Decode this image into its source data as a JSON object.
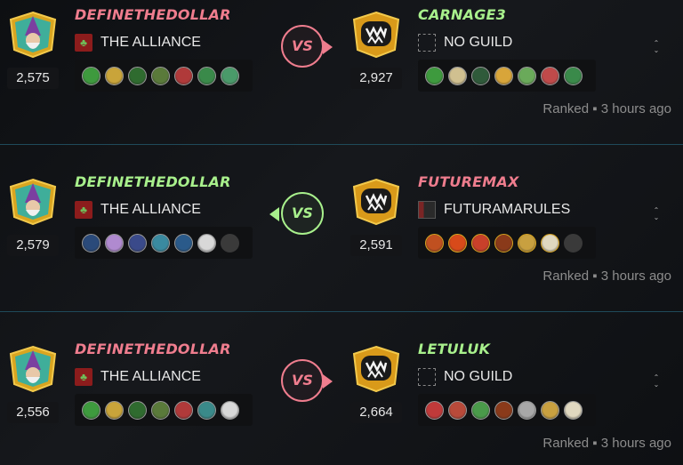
{
  "colors": {
    "win": "#ef7d8e",
    "loss": "#a8f08c",
    "divider": "#1f4a5a"
  },
  "battles": [
    {
      "player": {
        "name": "DEFINETHEDOLLAR",
        "name_color": "#ef7d8e",
        "rating": "2,575",
        "guild": "THE ALLIANCE",
        "guild_icon": "alliance-flag-icon"
      },
      "opponent": {
        "name": "CARNAGE3",
        "name_color": "#a8f08c",
        "rating": "2,927",
        "guild": "NO GUILD",
        "guild_icon": "no-guild-icon"
      },
      "vs_label": "VS",
      "vs_color": "#ef7d8e",
      "vs_arrow": "right",
      "meta": "Ranked ▪ 3 hours ago",
      "player_cards": [
        "#3e9a3e",
        "#c9a43a",
        "#2f6b2f",
        "#5a7a3a",
        "#b03a3a",
        "#3a8a4a",
        "#4a9a6a"
      ],
      "opponent_cards": [
        "#3e9a3e",
        "#d0c090",
        "#2f5a3a",
        "#d8a53a",
        "#6aaa5a",
        "#c04a4a",
        "#3a8a4a"
      ]
    },
    {
      "player": {
        "name": "DEFINETHEDOLLAR",
        "name_color": "#a8f08c",
        "rating": "2,579",
        "guild": "THE ALLIANCE",
        "guild_icon": "alliance-flag-icon"
      },
      "opponent": {
        "name": "FUTUREMAX",
        "name_color": "#ef7d8e",
        "rating": "2,591",
        "guild": "FUTURAMARULES",
        "guild_icon": "futura-guild-icon"
      },
      "vs_label": "VS",
      "vs_color": "#a8f08c",
      "vs_arrow": "left",
      "meta": "Ranked ▪ 3 hours ago",
      "player_cards": [
        "#2a4a7a",
        "#b08ad0",
        "#3a4a8a",
        "#3a8aa0",
        "#2a5a8a",
        "#d8d8d8",
        "#3a3a3a"
      ],
      "opponent_cards": [
        "#c05020",
        "#d84a1a",
        "#c8402a",
        "#8a3a1a",
        "#c8a040",
        "#e0d8c0",
        "#3a3a3a"
      ]
    },
    {
      "player": {
        "name": "DEFINETHEDOLLAR",
        "name_color": "#ef7d8e",
        "rating": "2,556",
        "guild": "THE ALLIANCE",
        "guild_icon": "alliance-flag-icon"
      },
      "opponent": {
        "name": "LETULUK",
        "name_color": "#a8f08c",
        "rating": "2,664",
        "guild": "NO GUILD",
        "guild_icon": "no-guild-icon"
      },
      "vs_label": "VS",
      "vs_color": "#ef7d8e",
      "vs_arrow": "right",
      "meta": "Ranked ▪ 3 hours ago",
      "player_cards": [
        "#3e9a3e",
        "#c9a43a",
        "#2f6b2f",
        "#5a7a3a",
        "#b03a3a",
        "#3a8a8a",
        "#d8d8d8"
      ],
      "opponent_cards": [
        "#c03a3a",
        "#b84a3a",
        "#4a9a4a",
        "#8a3a1a",
        "#a8a8a8",
        "#c8a040",
        "#e0d8c0"
      ]
    }
  ]
}
